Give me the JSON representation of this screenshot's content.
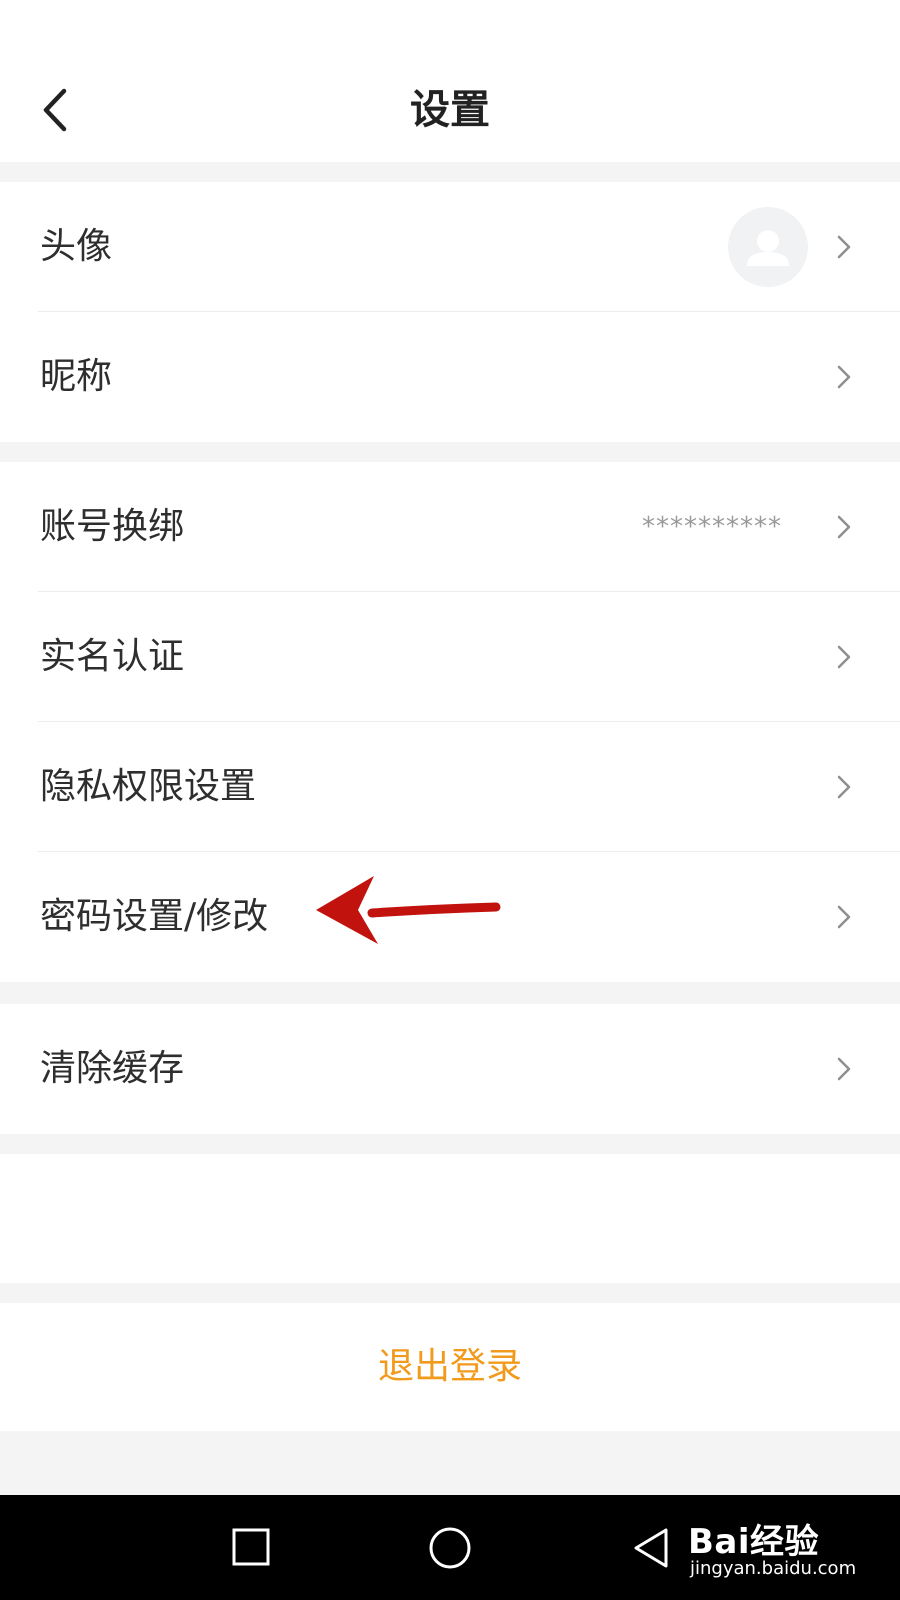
{
  "header": {
    "title": "设置"
  },
  "groups": [
    {
      "items": [
        {
          "label": "头像",
          "has_avatar": true
        },
        {
          "label": "昵称"
        }
      ]
    },
    {
      "items": [
        {
          "label": "账号换绑",
          "value": "**********"
        },
        {
          "label": "实名认证"
        },
        {
          "label": "隐私权限设置"
        },
        {
          "label": "密码设置/修改"
        }
      ]
    },
    {
      "items": [
        {
          "label": "清除缓存"
        }
      ]
    }
  ],
  "logout": {
    "label": "退出登录"
  },
  "colors": {
    "accent": "#f29a1b",
    "annotation_arrow": "#c1120e",
    "background": "#f4f4f4"
  },
  "navbar": {
    "icons": [
      "recent-apps-icon",
      "home-icon",
      "back-triangle-icon"
    ]
  },
  "watermark": {
    "main": "Bai经验",
    "sub": "jingyan.baidu.com"
  }
}
